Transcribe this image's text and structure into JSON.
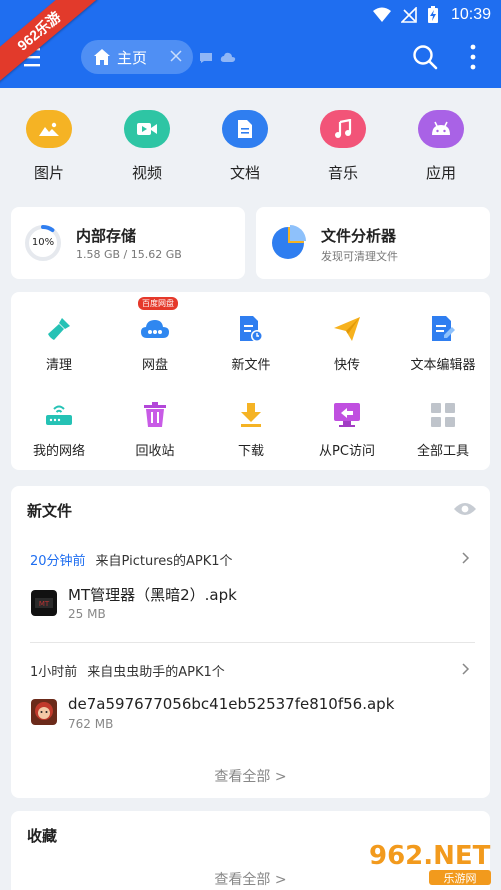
{
  "status": {
    "time": "10:39"
  },
  "watermark_top": "962乐游",
  "header": {
    "home_tab": "主页"
  },
  "categories": [
    {
      "label": "图片",
      "icon": "image-icon",
      "color": "#f5b324"
    },
    {
      "label": "视频",
      "icon": "video-icon",
      "color": "#2ec5a4"
    },
    {
      "label": "文档",
      "icon": "document-icon",
      "color": "#2f7ef0"
    },
    {
      "label": "音乐",
      "icon": "music-icon",
      "color": "#f25478"
    },
    {
      "label": "应用",
      "icon": "android-icon",
      "color": "#a962e6"
    }
  ],
  "storage": {
    "title": "内部存储",
    "percent": "10%",
    "used_fraction": 0.1,
    "detail": "1.58 GB / 15.62 GB"
  },
  "analyzer": {
    "title": "文件分析器",
    "subtitle": "发现可清理文件"
  },
  "tools": [
    {
      "label": "清理",
      "icon": "broom-icon"
    },
    {
      "label": "网盘",
      "icon": "cloud-drive-icon",
      "badge": "百度网盘"
    },
    {
      "label": "新文件",
      "icon": "new-file-icon"
    },
    {
      "label": "快传",
      "icon": "send-icon"
    },
    {
      "label": "文本编辑器",
      "icon": "text-editor-icon"
    },
    {
      "label": "我的网络",
      "icon": "router-icon"
    },
    {
      "label": "回收站",
      "icon": "trash-icon"
    },
    {
      "label": "下载",
      "icon": "download-icon"
    },
    {
      "label": "从PC访问",
      "icon": "pc-access-icon"
    },
    {
      "label": "全部工具",
      "icon": "all-tools-icon"
    }
  ],
  "new_files": {
    "title": "新文件",
    "groups": [
      {
        "when": "20分钟前",
        "source": "来自Pictures的APK1个",
        "file": {
          "name": "MT管理器（黑暗2）.apk",
          "size": "25 MB"
        }
      },
      {
        "when": "1小时前",
        "source": "来自虫虫助手的APK1个",
        "file": {
          "name": "de7a597677056bc41eb52537fe810f56.apk",
          "size": "762 MB"
        }
      }
    ],
    "view_all": "查看全部 >"
  },
  "favorites": {
    "title": "收藏",
    "view_all": "查看全部 >"
  },
  "watermark_bottom": {
    "brand": "962.NET",
    "sub": "乐游网"
  }
}
